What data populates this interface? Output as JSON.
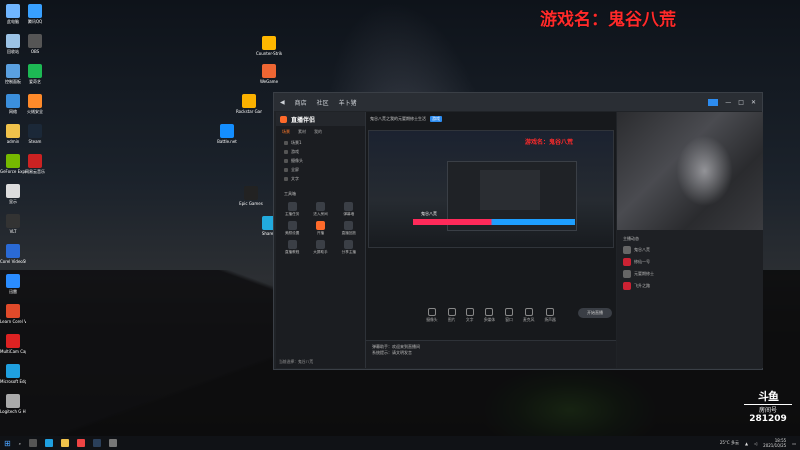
{
  "overlay": {
    "game_title": "游戏名：鬼谷八荒"
  },
  "desktop_icons": [
    {
      "label": "此电脑",
      "color": "#6fb5ff"
    },
    {
      "label": "回收站",
      "color": "#9bc3e6"
    },
    {
      "label": "控制面板",
      "color": "#5aa0e0"
    },
    {
      "label": "网络",
      "color": "#3b8fdc"
    },
    {
      "label": "admin",
      "color": "#f0c24b"
    },
    {
      "label": "GeForce Experience",
      "color": "#76b900"
    },
    {
      "label": "显示",
      "color": "#ddd"
    },
    {
      "label": "VLT",
      "color": "#333"
    },
    {
      "label": "Corel VideoStudio",
      "color": "#2a6ad6"
    },
    {
      "label": "迅雷",
      "color": "#2a8cff"
    },
    {
      "label": "Learn Corel VideoStudio",
      "color": "#e04a2a"
    },
    {
      "label": "MultiCam Capture Lite",
      "color": "#d22"
    },
    {
      "label": "Microsoft Edge",
      "color": "#1fa0e0"
    },
    {
      "label": "Logitech G HUB",
      "color": "#aaa"
    }
  ],
  "second_column_icons": [
    {
      "label": "腾讯QQ",
      "color": "#38a0ff"
    },
    {
      "label": "OBS",
      "color": "#555"
    },
    {
      "label": "爱奇艺",
      "color": "#1db954"
    },
    {
      "label": "火绒安全",
      "color": "#ff8a2a"
    },
    {
      "label": "Steam",
      "color": "#1b2838"
    },
    {
      "label": "网易云音乐",
      "color": "#c22"
    }
  ],
  "desktop_cluster": [
    {
      "label": "Counter-Strike Global Off...",
      "color": "#ffb700"
    },
    {
      "label": "WeGame",
      "color": "#e63"
    },
    {
      "label": "Rockstar Games",
      "color": "#fbb100"
    },
    {
      "label": "Battle.net",
      "color": "#148eff"
    },
    {
      "label": "Epic Games",
      "color": "#222"
    },
    {
      "label": "ShareX",
      "color": "#2ad"
    }
  ],
  "window": {
    "tabs": [
      "商店",
      "社区",
      "羊卜猪"
    ],
    "brand": "直播伴侣",
    "left_tabs": [
      "场景",
      "素材",
      "我的"
    ],
    "scene_rows": [
      "场景1",
      "游戏",
      "摄像头",
      "全屏",
      "文字"
    ],
    "tool_header": "工具箱",
    "tools": [
      "主播任务",
      "进入房间",
      "弹幕墙",
      "美颜设置",
      "开播",
      "直播回放",
      "直播教程",
      "大屏助手",
      "分享主播"
    ],
    "left_footer": "当前选择：鬼谷八荒",
    "stream_title": "鬼谷八荒之我的元婴期修士生活",
    "title_tag": "游戏",
    "preview_title": "游戏名：鬼谷八荒",
    "hp_label": "鬼谷八荒",
    "actions": [
      "摄像头",
      "图片",
      "文字",
      "多媒体",
      "窗口",
      "麦克风",
      "扬声器"
    ],
    "start_button": "开始直播",
    "chat_lines": [
      "弹幕助手：欢迎来到直播间",
      "系统提示：请文明发言"
    ],
    "right_list_header": "主播动态",
    "right_items": [
      "鬼谷八荒",
      "修仙一号",
      "元婴期修士",
      "飞升之路"
    ]
  },
  "badge": {
    "brand": "斗鱼",
    "sub": "房间号",
    "room": "281209"
  },
  "taskbar": {
    "weather": "25°C 多云",
    "time": "18:55",
    "date": "2021/10/25"
  }
}
